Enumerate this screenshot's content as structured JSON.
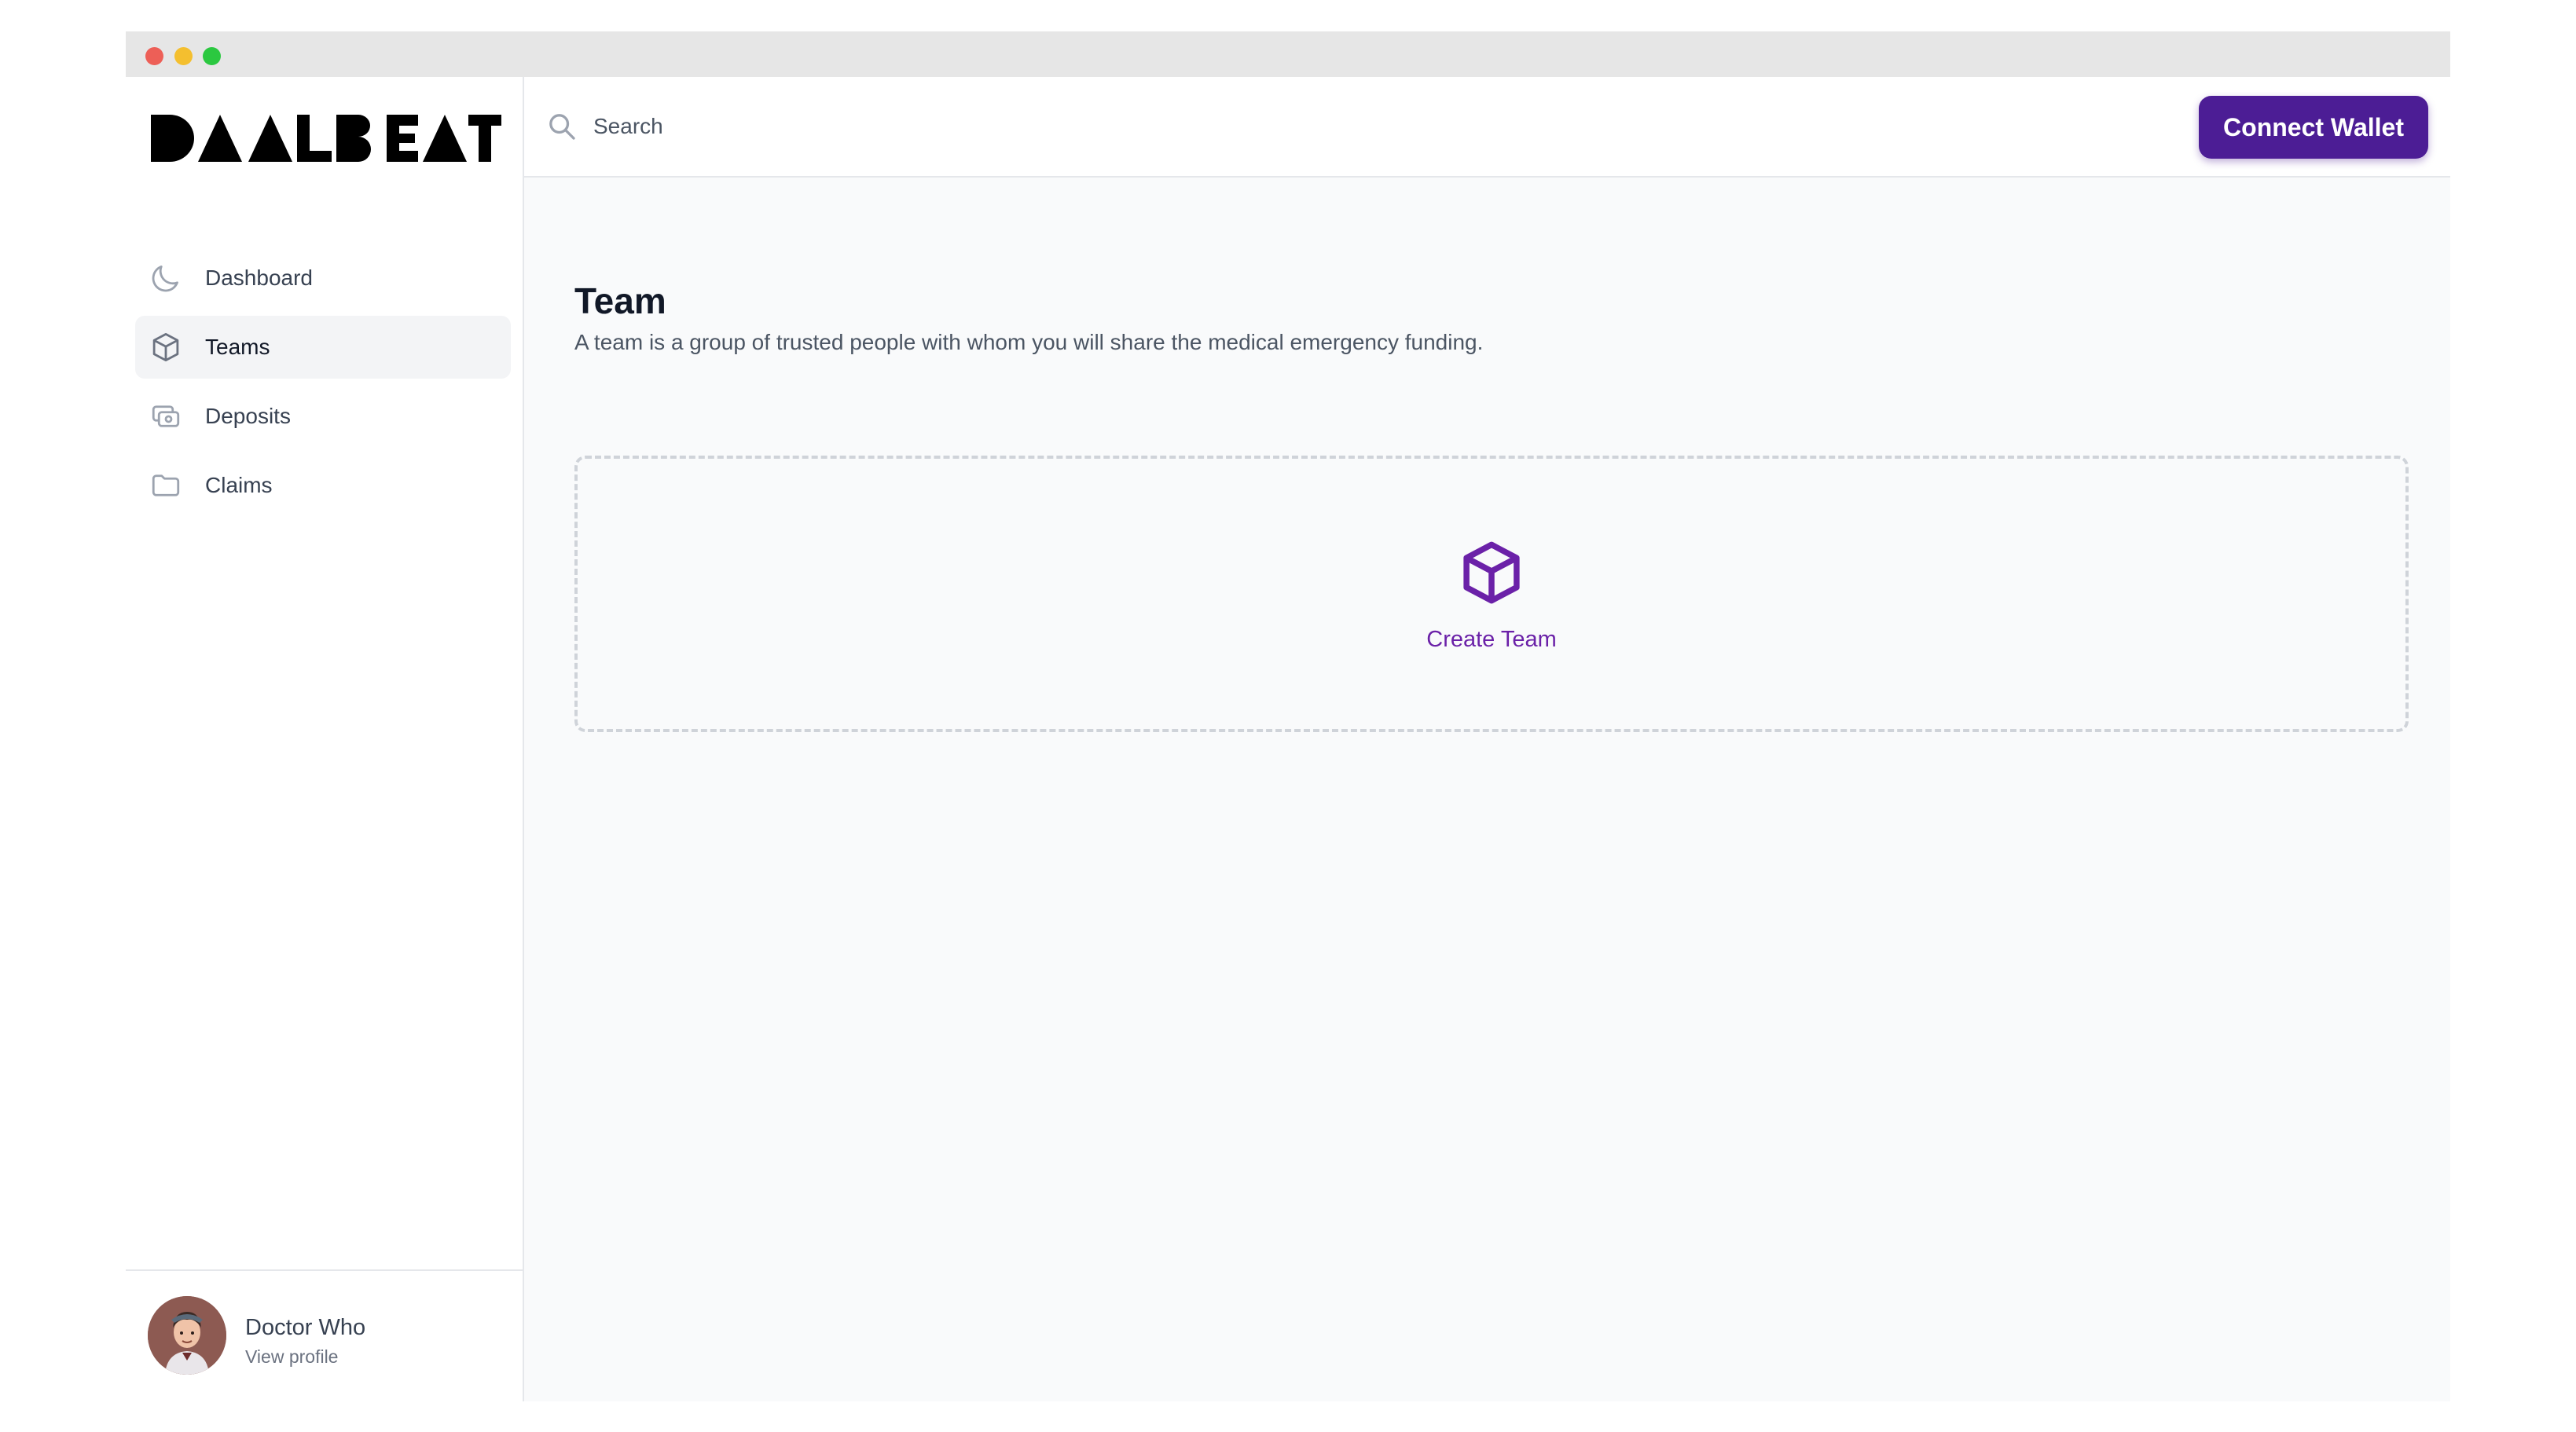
{
  "app": {
    "brand": "DAALBEAT"
  },
  "sidebar": {
    "items": [
      {
        "label": "Dashboard",
        "icon": "moon-icon",
        "active": false
      },
      {
        "label": "Teams",
        "icon": "cube-icon",
        "active": true
      },
      {
        "label": "Deposits",
        "icon": "cash-icon",
        "active": false
      },
      {
        "label": "Claims",
        "icon": "folder-icon",
        "active": false
      }
    ],
    "profile": {
      "name": "Doctor Who",
      "link": "View profile"
    }
  },
  "header": {
    "search": {
      "placeholder": "Search",
      "value": ""
    },
    "connect_wallet_label": "Connect Wallet"
  },
  "main": {
    "title": "Team",
    "description": "A team is a group of trusted people with whom you will share the medical emergency funding.",
    "create_team_label": "Create Team"
  },
  "colors": {
    "accent": "#4c1d95",
    "accent_text": "#6b21a8",
    "active_nav_bg": "#f3f4f6",
    "main_bg": "#f9fafb"
  }
}
